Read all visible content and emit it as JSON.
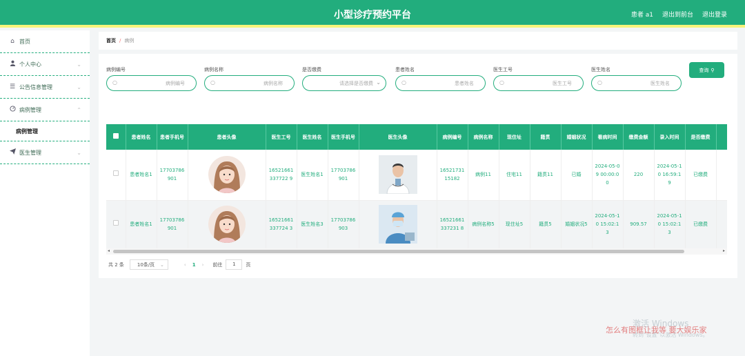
{
  "header": {
    "title": "小型诊疗预约平台",
    "links": [
      "患者 a1",
      "退出到前台",
      "退出登录"
    ]
  },
  "sidebar": {
    "items": [
      {
        "label": "首页",
        "icon": "home-icon"
      },
      {
        "label": "个人中心",
        "icon": "user-icon"
      },
      {
        "label": "公告信息管理",
        "icon": "list-icon"
      },
      {
        "label": "病例管理",
        "icon": "gauge-icon"
      },
      {
        "label": "医生管理",
        "icon": "send-icon"
      }
    ],
    "sub_item": "病例管理"
  },
  "breadcrumb": {
    "home": "首页",
    "sep": "/",
    "current": "病例"
  },
  "search": {
    "fields": [
      {
        "label": "病例编号",
        "placeholder": "病例编号"
      },
      {
        "label": "病例名称",
        "placeholder": "病例名称"
      },
      {
        "label": "是否缴费",
        "placeholder": "请选择是否缴费"
      },
      {
        "label": "患者姓名",
        "placeholder": "患者姓名"
      },
      {
        "label": "医生工号",
        "placeholder": "医生工号"
      },
      {
        "label": "医生姓名",
        "placeholder": "医生姓名"
      }
    ],
    "button": "查询"
  },
  "table": {
    "columns": [
      "患者姓名",
      "患者手机号",
      "患者头像",
      "医生工号",
      "医生姓名",
      "医生手机号",
      "医生头像",
      "病例编号",
      "病例名称",
      "现住址",
      "籍贯",
      "婚姻状况",
      "看病时间",
      "缴费金额",
      "录入时间",
      "是否缴费"
    ],
    "rows": [
      [
        "患者姓名1",
        "17703786901",
        "",
        "16521661337722 9",
        "医生姓名1",
        "17703786901",
        "",
        "1652173115182",
        "病例11",
        "住宅11",
        "籍贯11",
        "已婚",
        "2024-05-09 00:00:00",
        "220",
        "2024-05-10 16:59:19",
        "已缴费"
      ],
      [
        "患者姓名1",
        "17703786901",
        "",
        "16521661337724 3",
        "医生姓名3",
        "17703786903",
        "",
        "16521661337231 8",
        "病例名称5",
        "现住址5",
        "籍贯5",
        "婚姻状况5",
        "2024-05-10 15:02:13",
        "909.57",
        "2024-05-10 15:02:13",
        "已缴费"
      ]
    ]
  },
  "pagination": {
    "total": "共 2 条",
    "size": "10条/页",
    "prev": "‹",
    "page": "1",
    "next": "›",
    "goto": "前往",
    "goto_value": "1",
    "page_unit": "页"
  },
  "watermarks": {
    "windows": "激活 Windows",
    "windows_sub": "转到\"设置\"以激活 Windows。",
    "red": "怎么有图框让我等 要大娱乐家"
  },
  "colors": {
    "accent": "#22ad7d",
    "topbar_border": "#f7f47a"
  }
}
